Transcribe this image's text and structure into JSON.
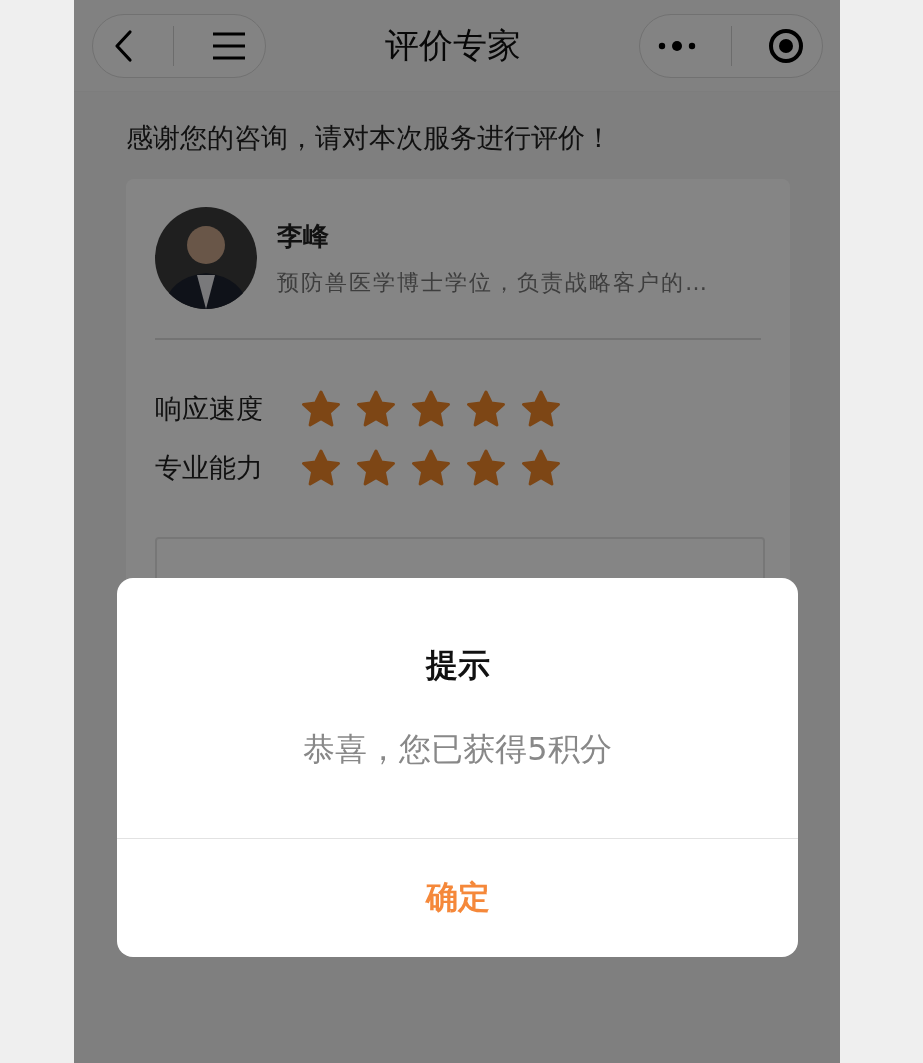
{
  "nav": {
    "title": "评价专家"
  },
  "intro": "感谢您的咨询，请对本次服务进行评价！",
  "expert": {
    "name": "李峰",
    "description": "预防兽医学博士学位，负责战略客户的…"
  },
  "ratings": [
    {
      "label": "响应速度",
      "stars": 5
    },
    {
      "label": "专业能力",
      "stars": 5
    }
  ],
  "dialog": {
    "title": "提示",
    "message": "恭喜，您已获得5积分",
    "button": "确定"
  }
}
